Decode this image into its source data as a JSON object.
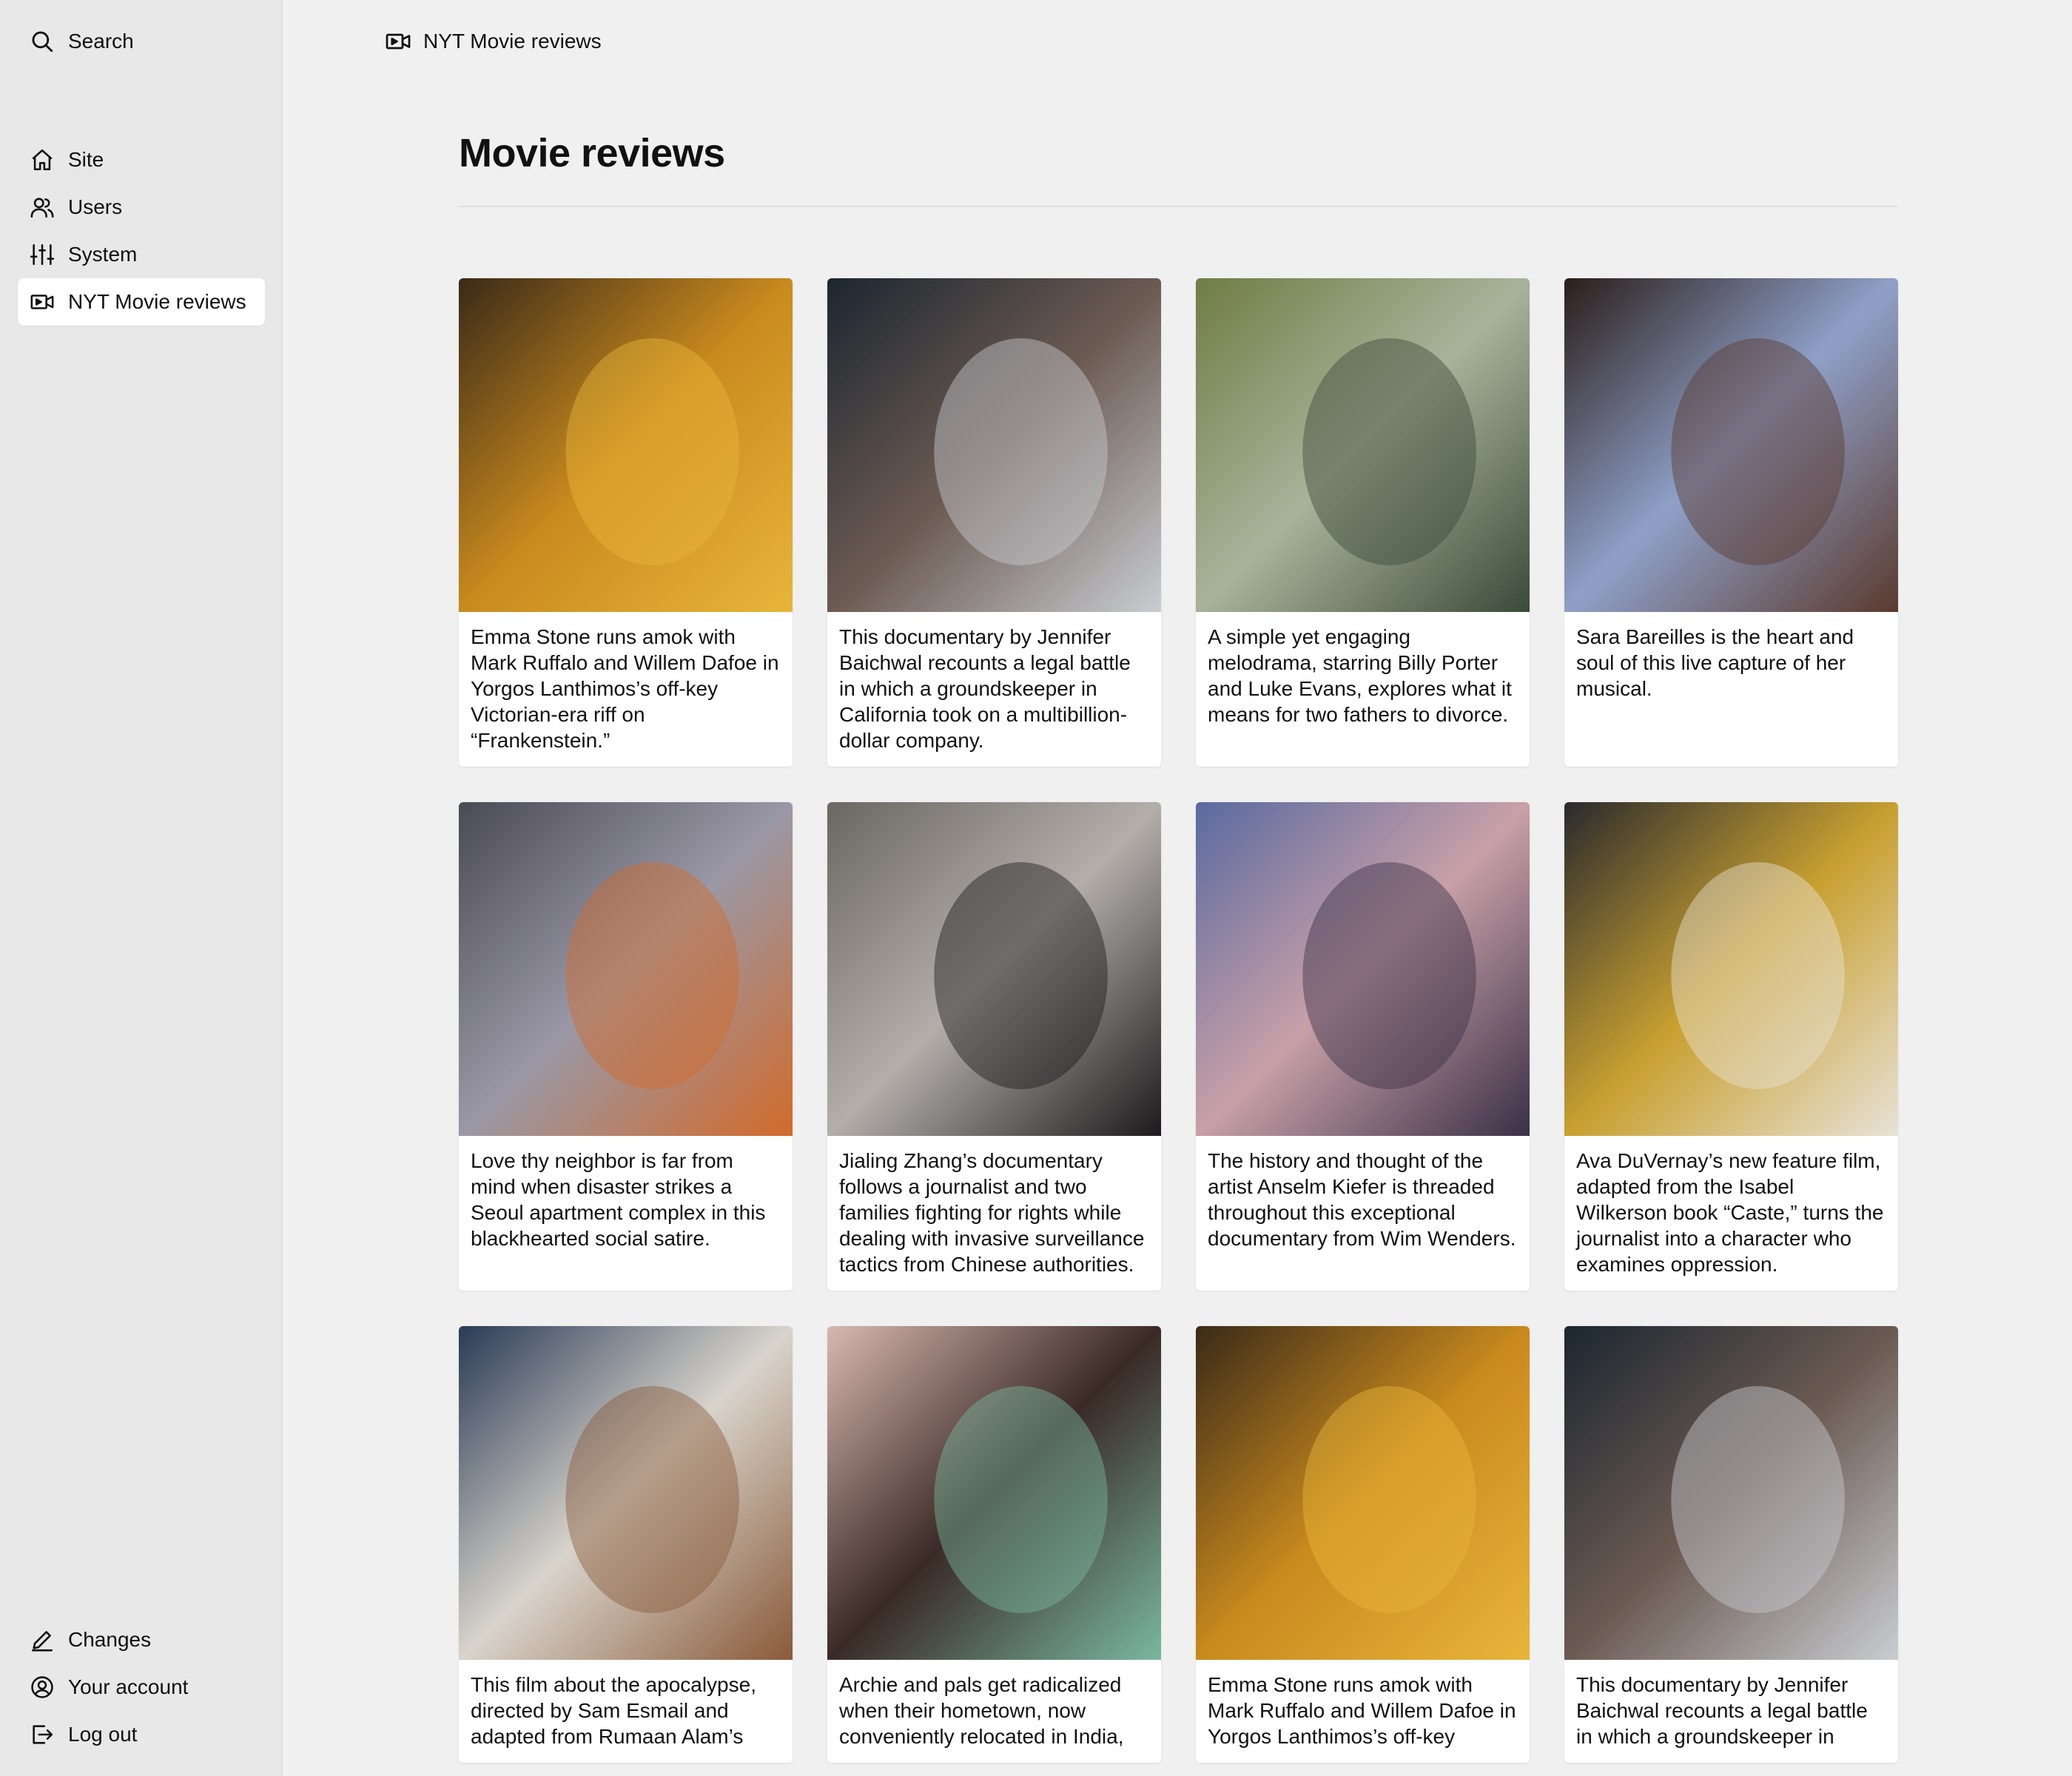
{
  "sidebar": {
    "search_label": "Search",
    "nav": [
      {
        "label": "Site",
        "icon": "home-icon"
      },
      {
        "label": "Users",
        "icon": "users-icon"
      },
      {
        "label": "System",
        "icon": "sliders-icon"
      },
      {
        "label": "NYT Movie reviews",
        "icon": "video-icon",
        "active": true
      }
    ],
    "bottom": [
      {
        "label": "Changes",
        "icon": "pencil-icon"
      },
      {
        "label": "Your account",
        "icon": "user-circle-icon"
      },
      {
        "label": "Log out",
        "icon": "logout-icon"
      }
    ]
  },
  "topbar": {
    "breadcrumb": "NYT Movie reviews"
  },
  "main": {
    "title": "Movie reviews",
    "cards": [
      {
        "caption": "Emma Stone runs amok with Mark Ruffalo and Willem Dafoe in Yorgos Lanthimos’s off-key Victorian-era riff on “Frankenstein.”",
        "image": "poor-things-still",
        "colors": [
          "#3a2a18",
          "#c98a1e",
          "#e8b53a"
        ]
      },
      {
        "caption": "This documentary by Jennifer Baichwal recounts a legal battle in which a groundskeeper in California took on a multibillion-dollar company.",
        "image": "groundskeeper-closeup-still",
        "colors": [
          "#1c2630",
          "#6b5a52",
          "#c9cdd2"
        ]
      },
      {
        "caption": "A simple yet engaging melodrama, starring Billy Porter and Luke Evans, explores what it means for two fathers to divorce.",
        "image": "park-walk-still",
        "colors": [
          "#6f7d45",
          "#a8b39a",
          "#3c4a3a"
        ]
      },
      {
        "caption": "Sara Bareilles is the heart and soul of this live capture of her musical.",
        "image": "waitress-still",
        "colors": [
          "#2a1e1a",
          "#8fa0c8",
          "#5a3a2e"
        ]
      },
      {
        "caption": "Love thy neighbor is far from mind when disaster strikes a Seoul apartment complex in this blackhearted social satire.",
        "image": "disaster-woman-still",
        "colors": [
          "#4a4a55",
          "#9a98a6",
          "#d26a2a"
        ]
      },
      {
        "caption": "Jialing Zhang’s documentary follows a journalist and two families fighting for rights while dealing with invasive surveillance tactics from Chinese authorities.",
        "image": "interview-woman-still",
        "colors": [
          "#6a6662",
          "#b3aeaa",
          "#1c1a1c"
        ]
      },
      {
        "caption": "The history and thought of the artist Anselm Kiefer is threaded throughout this exceptional documentary from Wim Wenders.",
        "image": "kiefer-dusk-still",
        "colors": [
          "#5a6aa0",
          "#c8a0a8",
          "#3a3046"
        ]
      },
      {
        "caption": "Ava DuVernay’s new feature film, adapted from the Isabel Wilkerson book “Caste,” turns the journalist into a character who examines oppression.",
        "image": "crowd-street-still",
        "colors": [
          "#2a2a2e",
          "#c8a030",
          "#e8e2d8"
        ]
      },
      {
        "caption": "This film about the apocalypse, directed by Sam Esmail and adapted from Rumaan Alam’s",
        "image": "family-group-still",
        "colors": [
          "#2a3a55",
          "#d8d4cc",
          "#8a5a3a"
        ]
      },
      {
        "caption": "Archie and pals get radicalized when their hometown, now conveniently relocated in India,",
        "image": "cake-couple-still",
        "colors": [
          "#d8b8b0",
          "#3a2a26",
          "#7ab8a0"
        ]
      },
      {
        "caption": "Emma Stone runs amok with Mark Ruffalo and Willem Dafoe in Yorgos Lanthimos’s off-key",
        "image": "poor-things-still",
        "colors": [
          "#3a2a18",
          "#c98a1e",
          "#e8b53a"
        ]
      },
      {
        "caption": "This documentary by Jennifer Baichwal recounts a legal battle in which a groundskeeper in",
        "image": "groundskeeper-closeup-still",
        "colors": [
          "#1c2630",
          "#6b5a52",
          "#c9cdd2"
        ]
      }
    ]
  }
}
